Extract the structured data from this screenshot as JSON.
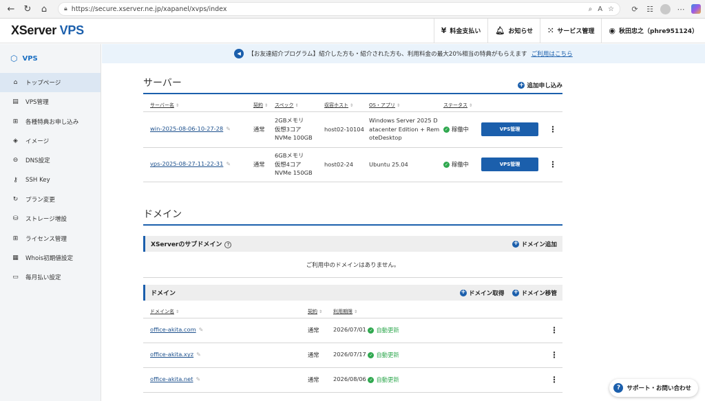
{
  "browser": {
    "url": "https://secure.xserver.ne.jp/xapanel/xvps/index"
  },
  "header": {
    "logo_main": "XServer",
    "logo_vps": "VPS",
    "billing": "料金支払い",
    "notice": "お知らせ",
    "services": "サービス管理",
    "user": "秋田忠之（phre951124）"
  },
  "sidebar": {
    "title": "VPS",
    "items": [
      {
        "label": "トップページ",
        "icon": "home-icon"
      },
      {
        "label": "VPS管理",
        "icon": "server-icon"
      },
      {
        "label": "各種特典お申し込み",
        "icon": "gift-icon"
      },
      {
        "label": "イメージ",
        "icon": "layers-icon"
      },
      {
        "label": "DNS設定",
        "icon": "globe-icon"
      },
      {
        "label": "SSH Key",
        "icon": "key-icon"
      },
      {
        "label": "プラン変更",
        "icon": "refresh-icon"
      },
      {
        "label": "ストレージ増設",
        "icon": "storage-icon"
      },
      {
        "label": "ライセンス管理",
        "icon": "windows-icon"
      },
      {
        "label": "Whois初期値設定",
        "icon": "document-icon"
      },
      {
        "label": "毎月払い設定",
        "icon": "card-icon"
      }
    ]
  },
  "banner": {
    "text": "【お友達紹介プログラム】紹介した方も・紹介された方も、利用料金の最大20%相当の特典がもらえます",
    "link": "ご利用はこちら"
  },
  "servers": {
    "title": "サーバー",
    "add_label": "追加申し込み",
    "columns": [
      "サーバー名",
      "契約",
      "スペック",
      "収容ホスト",
      "OS・アプリ",
      "ステータス"
    ],
    "rows": [
      {
        "name": "win-2025-08-06-10-27-28",
        "contract": "通常",
        "spec1": "2GBメモリ",
        "spec2": "仮想3コア",
        "spec3": "NVMe 100GB",
        "host": "host02-10104",
        "os": "Windows Server 2025 Datacenter Edition + RemoteDesktop",
        "status": "稼働中",
        "button": "VPS管理"
      },
      {
        "name": "vps-2025-08-27-11-22-31",
        "contract": "通常",
        "spec1": "6GBメモリ",
        "spec2": "仮想4コア",
        "spec3": "NVMe 150GB",
        "host": "host02-24",
        "os": "Ubuntu 25.04",
        "status": "稼働中",
        "button": "VPS管理"
      }
    ]
  },
  "domains": {
    "title": "ドメイン",
    "subdomain": {
      "title": "XServerのサブドメイン",
      "add_label": "ドメイン追加",
      "empty": "ご利用中のドメインはありません。"
    },
    "list": {
      "title": "ドメイン",
      "acquire_label": "ドメイン取得",
      "transfer_label": "ドメイン移管",
      "columns": [
        "ドメイン名",
        "契約",
        "利用期限"
      ],
      "rows": [
        {
          "name": "office-akita.com",
          "contract": "通常",
          "expiry": "2026/07/01",
          "renew": "自動更新"
        },
        {
          "name": "office-akita.xyz",
          "contract": "通常",
          "expiry": "2026/07/17",
          "renew": "自動更新"
        },
        {
          "name": "office-akita.net",
          "contract": "通常",
          "expiry": "2026/08/06",
          "renew": "自動更新"
        }
      ]
    }
  },
  "support": "サポート・お問い合わせ"
}
